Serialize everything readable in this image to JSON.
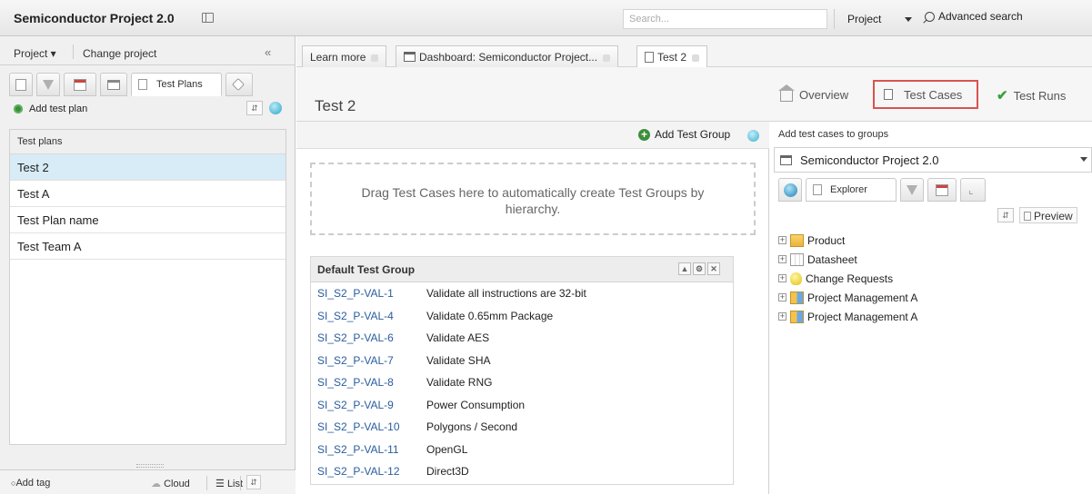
{
  "app": {
    "title": "Semiconductor Project 2.0",
    "search_placeholder": "Search...",
    "scope": "Project",
    "advanced_search": "Advanced search"
  },
  "left_panel": {
    "project_menu": "Project ▾",
    "change_project": "Change project",
    "collapse_glyph": "«",
    "active_tab": "Test Plans",
    "add_test_plan": "Add test plan",
    "list_header": "Test plans",
    "plans": [
      "Test 2",
      "Test A",
      "Test Plan name",
      "Test Team A"
    ],
    "selected_plan": "Test 2",
    "footer": {
      "add_tag": "Add tag",
      "cloud": "Cloud",
      "list": "List"
    }
  },
  "main_tabs": [
    {
      "label": "Learn more",
      "icon": "none"
    },
    {
      "label": "Dashboard: Semiconductor Project...",
      "icon": "project-icon"
    },
    {
      "label": "Test 2",
      "icon": "document-icon"
    }
  ],
  "page": {
    "title": "Test 2",
    "nav_overview": "Overview",
    "nav_test_cases": "Test Cases",
    "nav_test_runs": "Test Runs",
    "highlight_color": "#d9534f"
  },
  "center": {
    "add_test_group": "Add Test Group",
    "drop_hint": "Drag Test Cases here to automatically create Test Groups by hierarchy.",
    "group_title": "Default Test Group",
    "test_cases": [
      {
        "id": "SI_S2_P-VAL-1",
        "name": "Validate all instructions are 32-bit"
      },
      {
        "id": "SI_S2_P-VAL-4",
        "name": "Validate 0.65mm Package"
      },
      {
        "id": "SI_S2_P-VAL-6",
        "name": "Validate AES"
      },
      {
        "id": "SI_S2_P-VAL-7",
        "name": "Validate SHA"
      },
      {
        "id": "SI_S2_P-VAL-8",
        "name": "Validate RNG"
      },
      {
        "id": "SI_S2_P-VAL-9",
        "name": "Power Consumption"
      },
      {
        "id": "SI_S2_P-VAL-10",
        "name": "Polygons / Second"
      },
      {
        "id": "SI_S2_P-VAL-11",
        "name": "OpenGL"
      },
      {
        "id": "SI_S2_P-VAL-12",
        "name": "Direct3D"
      }
    ]
  },
  "right_panel": {
    "title": "Add test cases to groups",
    "project_select": "Semiconductor Project 2.0",
    "explorer_tab": "Explorer",
    "preview": "Preview",
    "tree": [
      {
        "label": "Product",
        "icon": "folder-icon"
      },
      {
        "label": "Datasheet",
        "icon": "sheet-icon"
      },
      {
        "label": "Change Requests",
        "icon": "bulb-icon"
      },
      {
        "label": "Project Management A",
        "icon": "grid-icon"
      },
      {
        "label": "Project Management A",
        "icon": "grid-icon"
      }
    ]
  }
}
